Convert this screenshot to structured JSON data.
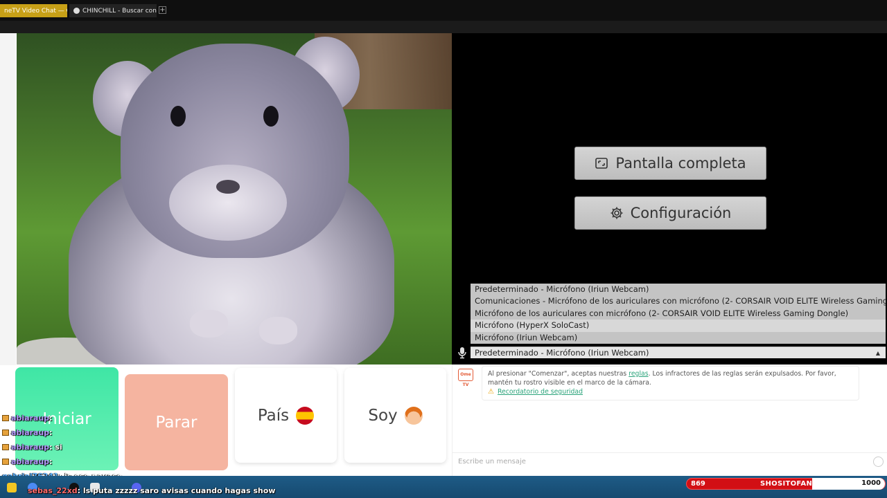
{
  "browser": {
    "tabs": [
      {
        "label": "neTV Video Chat — Om"
      },
      {
        "label": "CHINCHILL - Buscar con G"
      }
    ],
    "new_tab": "+"
  },
  "controls": {
    "fullscreen_label": "Pantalla completa",
    "settings_label": "Configuración",
    "start_label": "Iniciar",
    "stop_label": "Parar",
    "country_label": "País",
    "iam_label": "Soy"
  },
  "microphone": {
    "options": [
      "Predeterminado - Micrófono (Iriun Webcam)",
      "Comunicaciones - Micrófono de los auriculares con micrófono (2- CORSAIR VOID ELITE Wireless Gaming Dongle)",
      "Micrófono de los auriculares con micrófono (2- CORSAIR VOID ELITE Wireless Gaming Dongle)",
      "Micrófono (HyperX SoloCast)",
      "Micrófono (Iriun Webcam)"
    ],
    "selected": "Predeterminado - Micrófono (Iriun Webcam)"
  },
  "chat": {
    "notice_prefix": "Al presionar \"Comenzar\", aceptas nuestras ",
    "notice_link": "reglas",
    "notice_suffix": ". Los infractores de las reglas serán expulsados. Por favor, mantén tu rostro visible en el marco de la cámara.",
    "safety_link": "Recordatorio de seguridad",
    "input_placeholder": "Escribe un mensaje",
    "logo_text": "Ome TV"
  },
  "stream_overlay": {
    "messages": [
      {
        "user": "abiaraup",
        "text": ":"
      },
      {
        "user": "abiaraup",
        "text": ":"
      },
      {
        "user": "abiaraup",
        "text": ": si"
      },
      {
        "user": "abiaraup",
        "text": ":"
      },
      {
        "user": "gabriel76241",
        "text": ": is ese payaso"
      },
      {
        "user": "sebas_22xd",
        "text": ": ls puta zzzzz saro avisas cuando hagas show"
      }
    ],
    "sub_goal": {
      "current": "869",
      "label": "SHOSITOFANS",
      "target": "1000"
    }
  },
  "colors": {
    "start": "#3fe6a5",
    "stop": "#f5b4a0",
    "link": "#2aa37a",
    "sub_bar": "#d20f14"
  }
}
